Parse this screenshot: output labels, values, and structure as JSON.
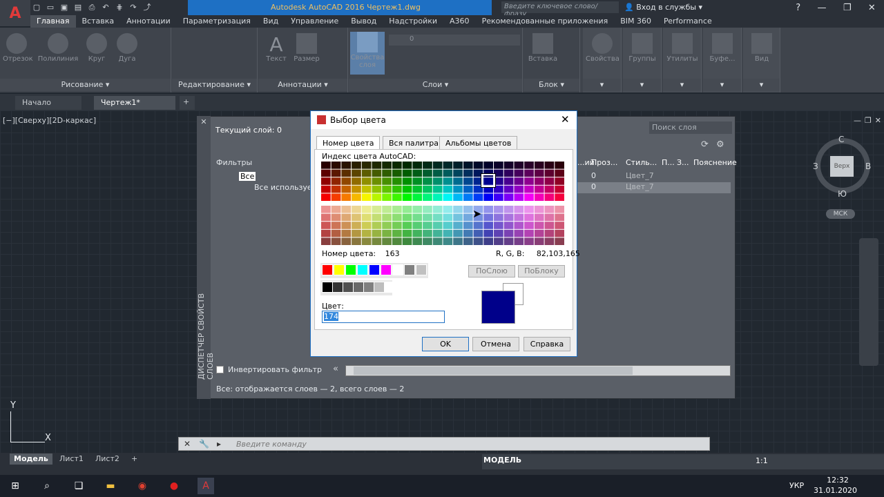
{
  "app": {
    "title": "Autodesk AutoCAD 2016    Чертеж1.dwg",
    "search_placeholder": "Введите ключевое слово/фразу",
    "login": "Вход в службы"
  },
  "ribbon_tabs": [
    "Главная",
    "Вставка",
    "Аннотации",
    "Параметризация",
    "Вид",
    "Управление",
    "Вывод",
    "Надстройки",
    "A360",
    "Рекомендованные приложения",
    "BIM 360",
    "Performance"
  ],
  "ribbon": {
    "draw_tools": [
      "Отрезок",
      "Полилиния",
      "Круг",
      "Дуга"
    ],
    "panels": [
      "Рисование",
      "Редактирование",
      "Аннотации",
      "Слои",
      "Блок"
    ],
    "anno_tools": [
      "Текст",
      "Размер"
    ],
    "layer_tool": "Свойства слоя",
    "layer_value": "0",
    "block_tool": "Вставка",
    "extra_tools": [
      "Свойства",
      "Группы",
      "Утилиты",
      "Буфе...",
      "Вид"
    ]
  },
  "doc_tabs": [
    "Начало",
    "Чертеж1*"
  ],
  "viewport_label": "[−][Сверху][2D-каркас]",
  "layer_manager": {
    "vertical_title": "ДИСПЕТЧЕР СВОЙСТВ СЛОЕВ",
    "current_layer": "Текущий слой: 0",
    "search": "Поиск слоя",
    "filters_header": "Фильтры",
    "tree_all": "Все",
    "tree_used": "Все используем",
    "columns": [
      "...ий",
      "Проз...",
      "Стиль...",
      "П...",
      "З...",
      "Пояснение"
    ],
    "rows": [
      {
        "transp": "0",
        "style": "Цвет_7"
      },
      {
        "transp": "0",
        "style": "Цвет_7"
      }
    ],
    "invert_filter": "Инвертировать фильтр",
    "status": "Все: отображается слоев — 2, всего слоев — 2"
  },
  "dialog": {
    "title": "Выбор цвета",
    "tabs": [
      "Номер цвета",
      "Вся палитра",
      "Альбомы цветов"
    ],
    "aci_label": "Индекс цвета AutoCAD:",
    "color_number_label": "Номер цвета:",
    "color_number": "163",
    "rgb_label": "R, G, B:",
    "rgb_value": "82,103,165",
    "bylayer": "ПоСлою",
    "byblock": "ПоБлоку",
    "color_label": "Цвет:",
    "color_value": "174",
    "preview_color": "#00008a",
    "ok": "OK",
    "cancel": "Отмена",
    "help": "Справка"
  },
  "viewcube": {
    "top": "Верх",
    "north": "С",
    "south": "Ю",
    "west": "З",
    "east": "В",
    "ucs": "МСК"
  },
  "ucs": {
    "x": "X",
    "y": "Y"
  },
  "command": {
    "placeholder": "Введите команду"
  },
  "layout_tabs": [
    "Модель",
    "Лист1",
    "Лист2"
  ],
  "status": {
    "model": "МОДЕЛЬ",
    "scale": "1:1"
  },
  "taskbar": {
    "lang": "УКР",
    "time": "12:32",
    "date": "31.01.2020"
  }
}
